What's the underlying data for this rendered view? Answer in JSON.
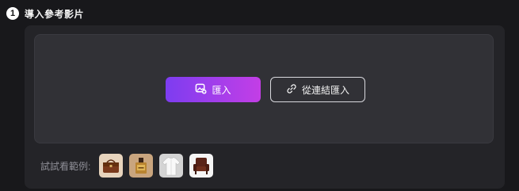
{
  "header": {
    "step_number": "1",
    "title": "導入參考影片"
  },
  "dropzone": {
    "import_button": {
      "label": "匯入",
      "icon": "image-add-icon"
    },
    "link_button": {
      "label": "從連結匯入",
      "icon": "link-icon"
    }
  },
  "samples": {
    "label": "試試看範例:",
    "items": [
      {
        "name": "brown leather handbag",
        "icon": "handbag-icon"
      },
      {
        "name": "perfume bottle",
        "icon": "perfume-icon"
      },
      {
        "name": "white shirt",
        "icon": "shirt-icon"
      },
      {
        "name": "leather armchair",
        "icon": "armchair-icon"
      }
    ]
  },
  "colors": {
    "background": "#18181b",
    "panel": "#242428",
    "dropzone": "#313136",
    "accent_start": "#7d3df0",
    "accent_end": "#c33ee6"
  }
}
